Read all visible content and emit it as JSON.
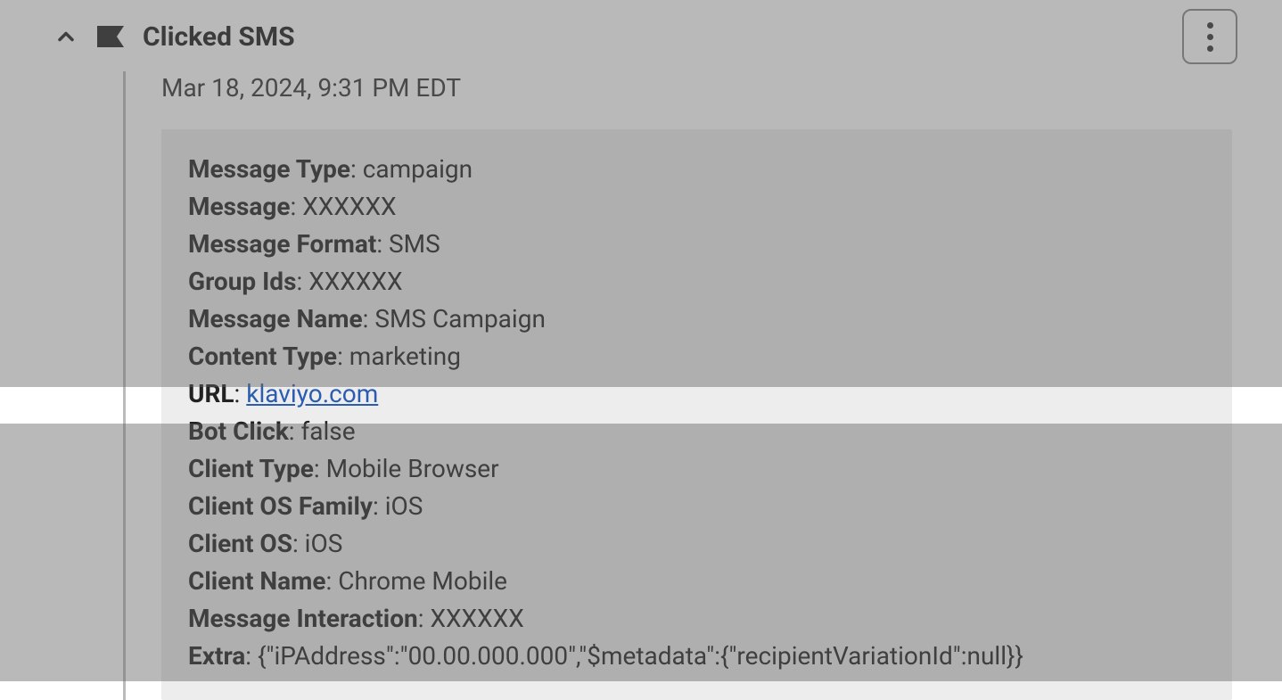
{
  "event": {
    "title": "Clicked SMS",
    "timestamp": "Mar 18, 2024, 9:31 PM EDT",
    "details": [
      {
        "label": "Message Type",
        "value": "campaign",
        "link": false
      },
      {
        "label": "Message",
        "value": "XXXXXX",
        "link": false
      },
      {
        "label": "Message Format",
        "value": "SMS",
        "link": false
      },
      {
        "label": "Group Ids",
        "value": "XXXXXX",
        "link": false
      },
      {
        "label": "Message Name",
        "value": "SMS Campaign",
        "link": false
      },
      {
        "label": "Content Type",
        "value": "marketing",
        "link": false
      },
      {
        "label": "URL",
        "value": "klaviyo.com",
        "link": true
      },
      {
        "label": "Bot Click",
        "value": "false",
        "link": false,
        "highlight": true
      },
      {
        "label": "Client Type",
        "value": "Mobile Browser",
        "link": false
      },
      {
        "label": "Client OS Family",
        "value": "iOS",
        "link": false
      },
      {
        "label": "Client OS",
        "value": "iOS",
        "link": false
      },
      {
        "label": "Client Name",
        "value": "Chrome Mobile",
        "link": false
      },
      {
        "label": "Message Interaction",
        "value": "XXXXXX",
        "link": false
      },
      {
        "label": "Extra",
        "value": "{\"iPAddress\":\"00.00.000.000\",\"$metadata\":{\"recipientVariationId\":null}}",
        "link": false
      }
    ]
  }
}
